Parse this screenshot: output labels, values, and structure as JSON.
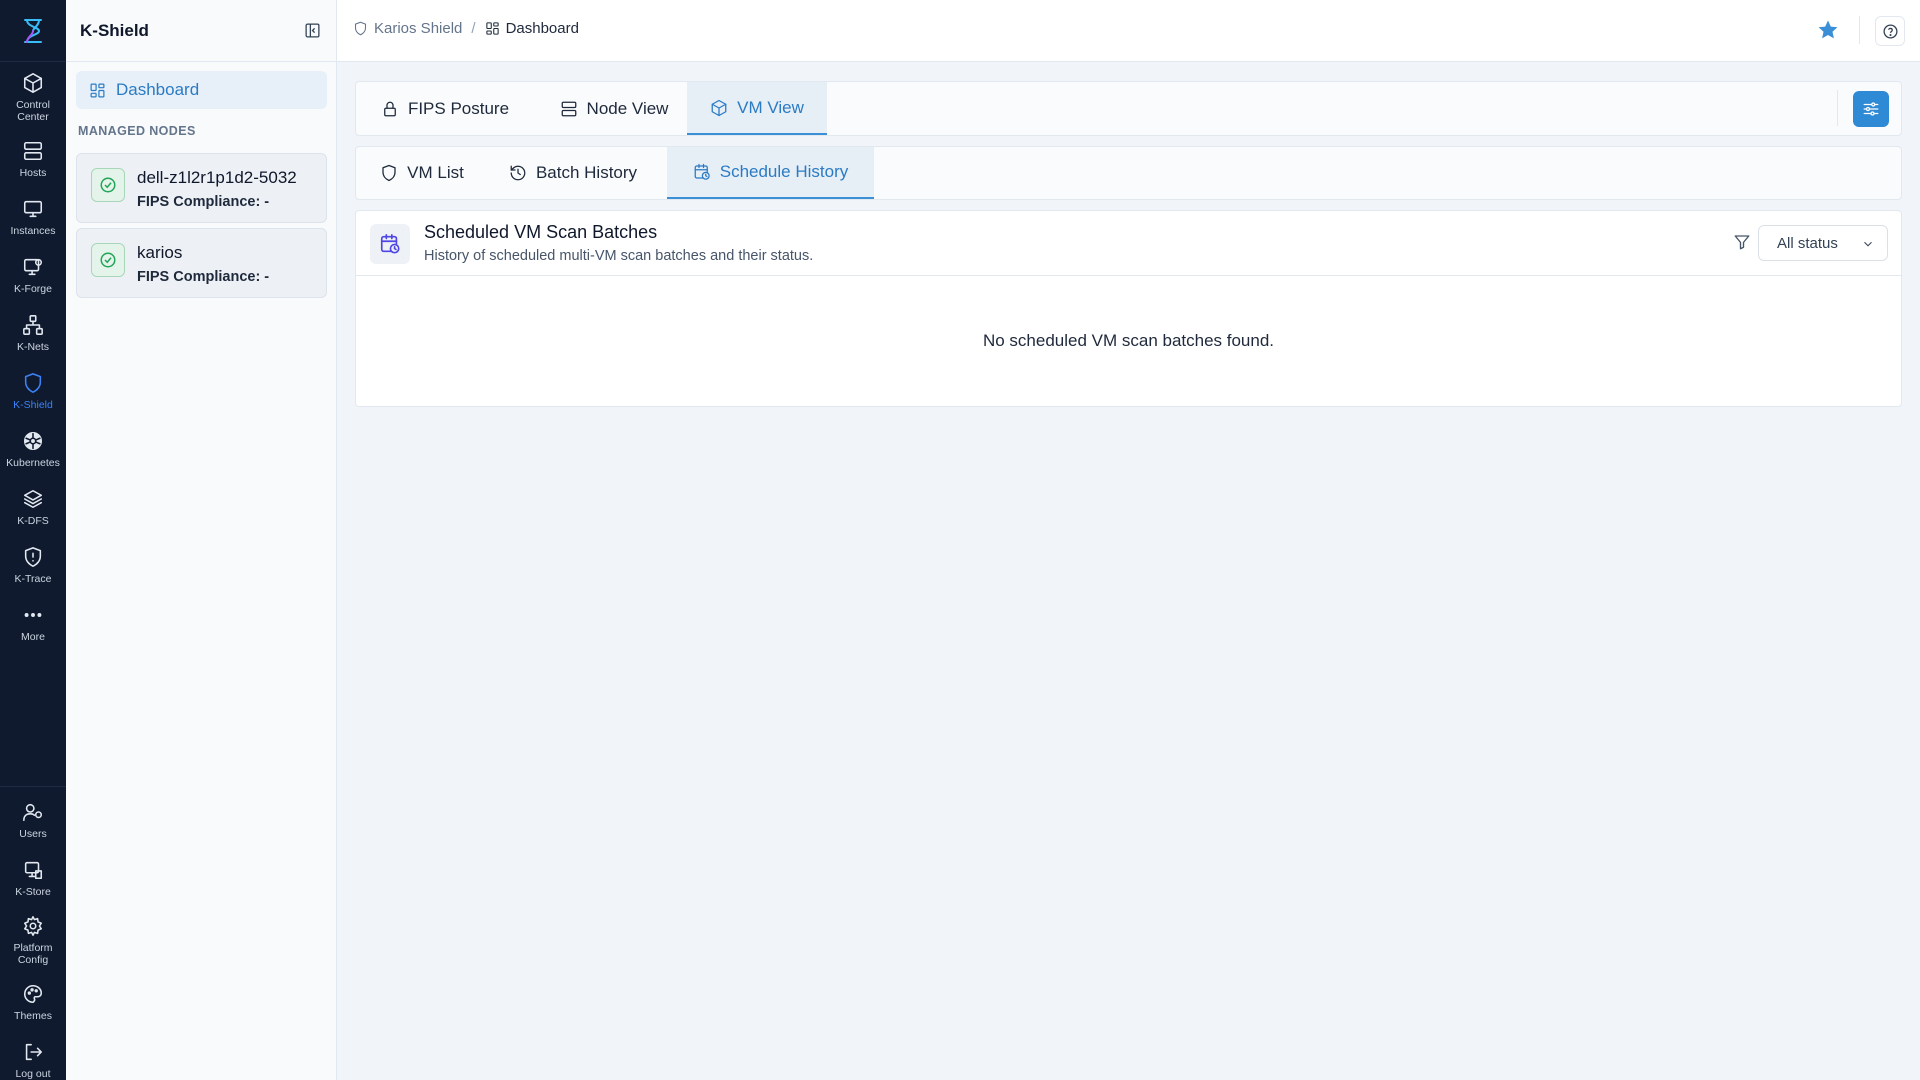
{
  "app": {
    "name": "K-Shield"
  },
  "rail": {
    "items": [
      {
        "label": "Control Center",
        "icon": "cube-icon"
      },
      {
        "label": "Hosts",
        "icon": "server-icon"
      },
      {
        "label": "Instances",
        "icon": "monitor-icon"
      },
      {
        "label": "K-Forge",
        "icon": "forge-icon"
      },
      {
        "label": "K-Nets",
        "icon": "network-icon"
      },
      {
        "label": "K-Shield",
        "icon": "shield-icon"
      },
      {
        "label": "Kubernetes",
        "icon": "helm-icon"
      },
      {
        "label": "K-DFS",
        "icon": "layers-icon"
      },
      {
        "label": "K-Trace",
        "icon": "shield-alert-icon"
      },
      {
        "label": "More",
        "icon": "more-icon"
      }
    ],
    "bottom": [
      {
        "label": "Users",
        "icon": "users-icon"
      },
      {
        "label": "K-Store",
        "icon": "store-icon"
      },
      {
        "label": "Platform Config",
        "icon": "gear-icon"
      },
      {
        "label": "Themes",
        "icon": "palette-icon"
      },
      {
        "label": "Log out",
        "icon": "logout-icon"
      }
    ],
    "active": "K-Shield",
    "accent_color": "#3b82f6"
  },
  "sidebar": {
    "title": "K-Shield",
    "nav_dashboard": "Dashboard",
    "section_label": "MANAGED NODES",
    "nodes": [
      {
        "name": "dell-z1l2r1p1d2-5032",
        "compliance": "FIPS Compliance: -"
      },
      {
        "name": "karios",
        "compliance": "FIPS Compliance: -"
      }
    ]
  },
  "breadcrumb": {
    "root": "Karios Shield",
    "separator": "/",
    "current": "Dashboard"
  },
  "main_tabs": [
    {
      "label": "FIPS Posture",
      "icon": "lock-icon"
    },
    {
      "label": "Node View",
      "icon": "server-icon"
    },
    {
      "label": "VM View",
      "icon": "box-icon",
      "active": true
    }
  ],
  "sub_tabs": [
    {
      "label": "VM List",
      "icon": "shield-icon"
    },
    {
      "label": "Batch History",
      "icon": "history-icon"
    },
    {
      "label": "Schedule History",
      "icon": "calendar-clock-icon",
      "active": true
    }
  ],
  "panel": {
    "title": "Scheduled VM Scan Batches",
    "subtitle": "History of scheduled multi-VM scan batches and their status.",
    "status_filter": "All status",
    "empty_message": "No scheduled VM scan batches found."
  },
  "colors": {
    "primary": "#2f8ad6",
    "active_tab_text": "#2b7bc4",
    "success": "#22a559",
    "rail_bg": "#0f1a2e"
  }
}
